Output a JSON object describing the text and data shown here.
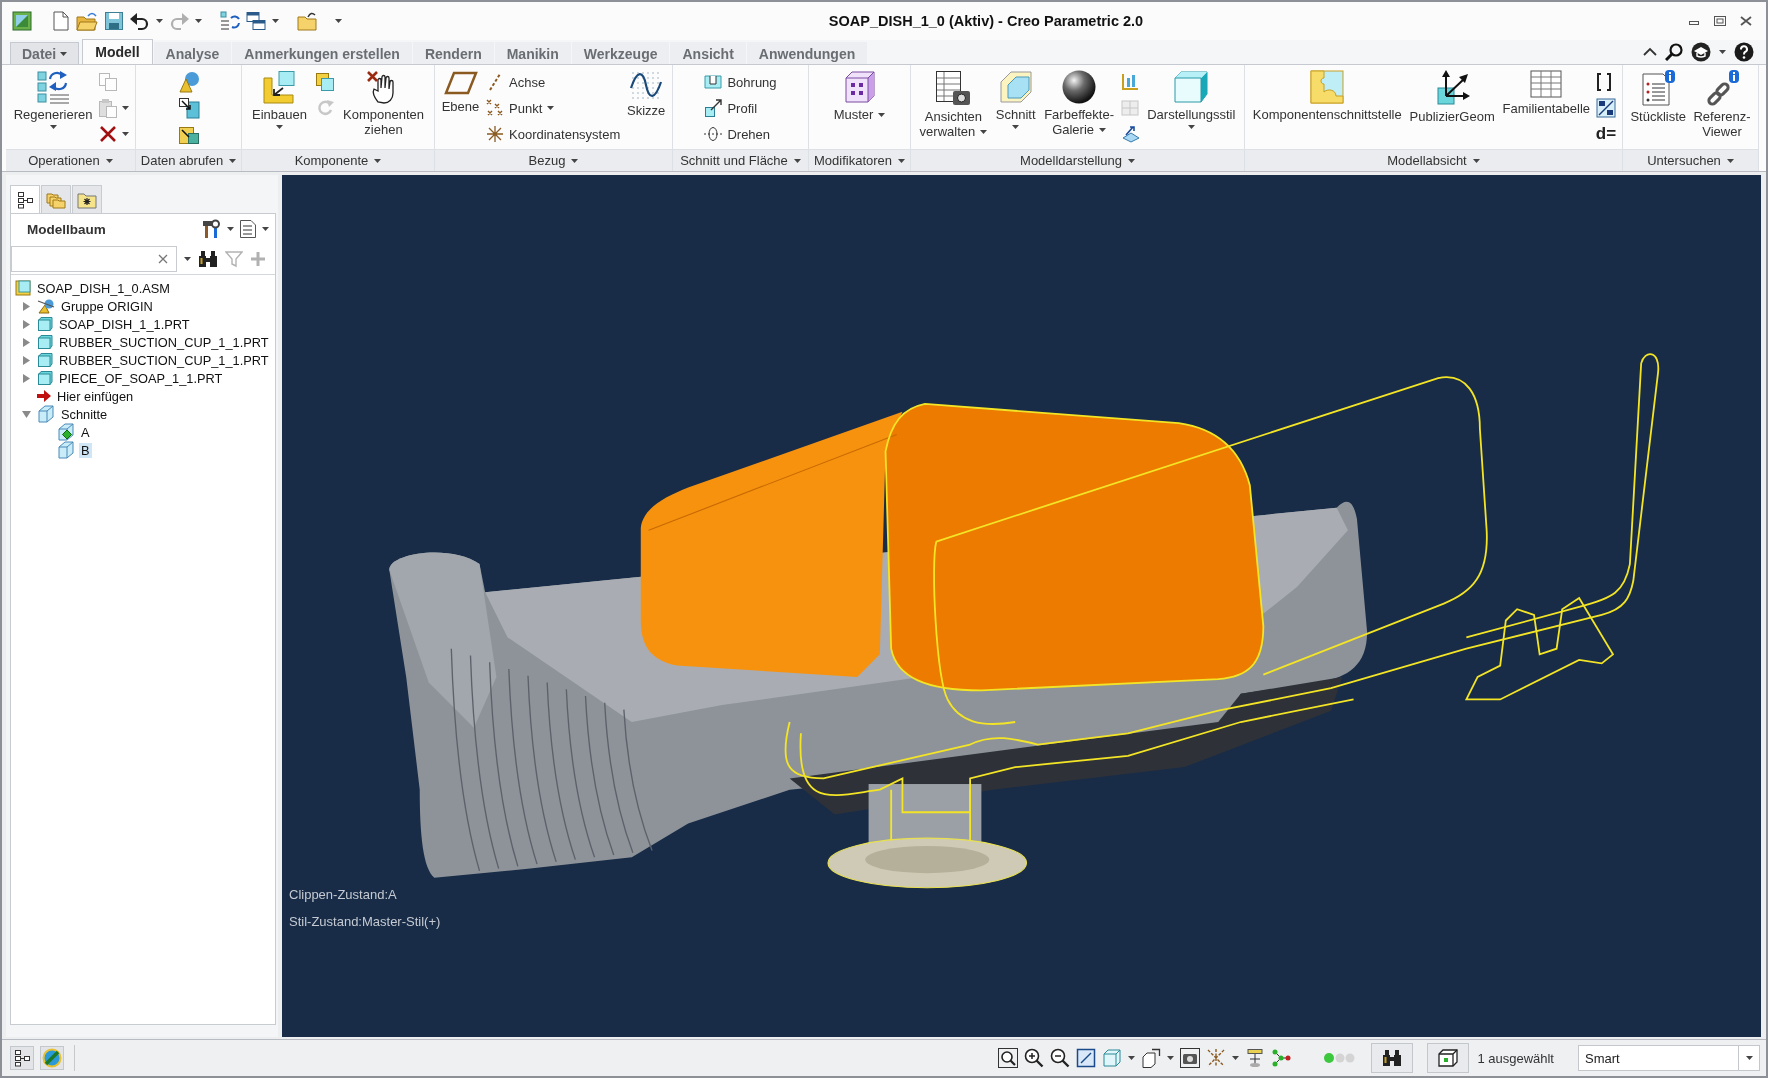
{
  "window": {
    "title": "SOAP_DISH_1_0 (Aktiv) - Creo Parametric 2.0"
  },
  "quick_access_toolbar": [
    {
      "disabled": false,
      "dropdown": false
    },
    {
      "disabled": false,
      "dropdown": false
    },
    {
      "disabled": false,
      "dropdown": false
    },
    {
      "disabled": false,
      "dropdown": true
    },
    {
      "disabled": true,
      "dropdown": true
    },
    {
      "disabled": false,
      "dropdown": false
    },
    {
      "disabled": false,
      "dropdown": true
    },
    {
      "disabled": false,
      "dropdown": false
    }
  ],
  "ribbon_tabs": [
    {
      "label": "Datei",
      "kind": "menu",
      "selected": false
    },
    {
      "label": "Modell",
      "kind": "tab",
      "selected": true
    },
    {
      "label": "Analyse",
      "kind": "tab",
      "selected": false
    },
    {
      "label": "Anmerkungen erstellen",
      "kind": "tab",
      "selected": false
    },
    {
      "label": "Rendern",
      "kind": "tab",
      "selected": false
    },
    {
      "label": "Manikin",
      "kind": "tab",
      "selected": false
    },
    {
      "label": "Werkzeuge",
      "kind": "tab",
      "selected": false
    },
    {
      "label": "Ansicht",
      "kind": "tab",
      "selected": false
    },
    {
      "label": "Anwendungen",
      "kind": "tab",
      "selected": false
    }
  ],
  "ribbon_groups": [
    {
      "label": "Operationen",
      "columns": [
        {
          "kind": "large",
          "label": "Regenerieren",
          "dropdown": true
        },
        {
          "kind": "stack",
          "items": [
            {
              "kind": "icon",
              "disabled": true,
              "dropdown": false
            },
            {
              "kind": "icon",
              "disabled": true,
              "dropdown": true
            },
            {
              "kind": "icon",
              "disabled": false,
              "dropdown": true
            }
          ]
        }
      ]
    },
    {
      "label": "Daten abrufen",
      "columns": [
        {
          "kind": "stack",
          "items": [
            {
              "kind": "icon",
              "disabled": false,
              "dropdown": false
            },
            {
              "kind": "icon",
              "disabled": false,
              "dropdown": false
            },
            {
              "kind": "icon",
              "disabled": false,
              "dropdown": false
            }
          ]
        }
      ]
    },
    {
      "label": "Komponente",
      "columns": [
        {
          "kind": "large",
          "label": "Einbauen",
          "dropdown": true
        },
        {
          "kind": "stack",
          "items": [
            {
              "kind": "icon",
              "disabled": false,
              "dropdown": false
            },
            {
              "kind": "icon",
              "disabled": true,
              "dropdown": false
            }
          ]
        },
        {
          "kind": "large",
          "label": "Komponenten\nziehen",
          "dropdown": false
        }
      ]
    },
    {
      "label": "Bezug",
      "columns": [
        {
          "kind": "large",
          "label": "Ebene",
          "dropdown": false
        },
        {
          "kind": "stack",
          "items": [
            {
              "kind": "small",
              "label": "Achse",
              "disabled": false,
              "dropdown": false
            },
            {
              "kind": "small",
              "label": "Punkt",
              "disabled": false,
              "dropdown": true
            },
            {
              "kind": "small",
              "label": "Koordinatensystem",
              "disabled": false,
              "dropdown": false
            }
          ]
        },
        {
          "kind": "large",
          "label": "Skizze",
          "dropdown": false
        }
      ]
    },
    {
      "label": "Schnitt und Fläche",
      "columns": [
        {
          "kind": "stack",
          "items": [
            {
              "kind": "small",
              "label": "Bohrung",
              "disabled": false,
              "dropdown": false
            },
            {
              "kind": "small",
              "label": "Profil",
              "disabled": false,
              "dropdown": false
            },
            {
              "kind": "small",
              "label": "Drehen",
              "disabled": false,
              "dropdown": false
            }
          ]
        }
      ]
    },
    {
      "label": "Modifikatoren",
      "columns": [
        {
          "kind": "large_inline",
          "label": "Muster",
          "dropdown": true
        }
      ]
    },
    {
      "label": "Modelldarstellung",
      "columns": [
        {
          "kind": "large_inline",
          "label": "Ansichten\nverwalten",
          "dropdown": true
        },
        {
          "kind": "large",
          "label": "Schnitt",
          "dropdown": true
        },
        {
          "kind": "large_inline",
          "label": "Farbeffekte-\nGalerie",
          "dropdown": true
        },
        {
          "kind": "stack",
          "items": [
            {
              "kind": "icon",
              "disabled": false,
              "dropdown": false
            },
            {
              "kind": "icon",
              "disabled": true,
              "dropdown": false
            },
            {
              "kind": "icon",
              "disabled": false,
              "dropdown": false
            }
          ]
        },
        {
          "kind": "large",
          "label": "Darstellungsstil",
          "dropdown": true
        }
      ]
    },
    {
      "label": "Modellabsicht",
      "columns": [
        {
          "kind": "large",
          "label": "Komponentenschnittstelle",
          "dropdown": false
        },
        {
          "kind": "large",
          "label": "PublizierGeom",
          "dropdown": false
        },
        {
          "kind": "large",
          "label": "Familientabelle",
          "dropdown": false
        },
        {
          "kind": "stack",
          "items": [
            {
              "kind": "icon",
              "disabled": false,
              "dropdown": false
            },
            {
              "kind": "icon",
              "disabled": false,
              "dropdown": false
            },
            {
              "kind": "glyph",
              "label": "d=",
              "disabled": false,
              "dropdown": false
            }
          ]
        }
      ]
    },
    {
      "label": "Untersuchen",
      "columns": [
        {
          "kind": "large",
          "label": "Stückliste",
          "dropdown": false
        },
        {
          "kind": "large",
          "label": "Referenz-\nViewer",
          "dropdown": false
        }
      ]
    }
  ],
  "navigator_tabs": [
    {
      "selected": true
    },
    {
      "selected": false
    },
    {
      "selected": false
    }
  ],
  "model_tree": {
    "title": "Modellbaum",
    "tools": [
      {
        "disabled": false
      },
      {
        "disabled": true
      },
      {
        "disabled": true
      }
    ],
    "items": [
      {
        "label": "SOAP_DISH_1_0.ASM",
        "kind": "assembly",
        "selected": false,
        "children": [
          {
            "label": "Gruppe ORIGIN",
            "kind": "group",
            "expanded": false,
            "selected": false
          },
          {
            "label": "SOAP_DISH_1_1.PRT",
            "kind": "part",
            "expanded": false,
            "selected": false
          },
          {
            "label": "RUBBER_SUCTION_CUP_1_1.PRT",
            "kind": "part",
            "expanded": false,
            "selected": false
          },
          {
            "label": "RUBBER_SUCTION_CUP_1_1.PRT",
            "kind": "part",
            "expanded": false,
            "selected": false
          },
          {
            "label": "PIECE_OF_SOAP_1_1.PRT",
            "kind": "part",
            "expanded": false,
            "selected": false
          },
          {
            "label": "Hier einfügen",
            "kind": "insert",
            "selected": false
          },
          {
            "label": "Schnitte",
            "kind": "sections",
            "expanded": true,
            "selected": false,
            "children": [
              {
                "label": "A",
                "kind": "section",
                "selected": false,
                "active": true
              },
              {
                "label": "B",
                "kind": "section",
                "selected": true,
                "active": false
              }
            ]
          }
        ]
      }
    ]
  },
  "viewport": {
    "status_lines": [
      "Clippen-Zustand:A",
      "Stil-Zustand:Master-Stil(+)"
    ]
  },
  "status_bar": {
    "view_tools": [
      {
        "dropdown": false
      },
      {
        "dropdown": false
      },
      {
        "dropdown": false
      },
      {
        "dropdown": false
      },
      {
        "dropdown": true
      },
      {
        "dropdown": true
      },
      {
        "dropdown": false
      },
      {
        "dropdown": true
      },
      {
        "dropdown": false
      },
      {
        "dropdown": false
      }
    ],
    "selection_count": "1 ausgewählt",
    "selection_filter": "Smart"
  }
}
